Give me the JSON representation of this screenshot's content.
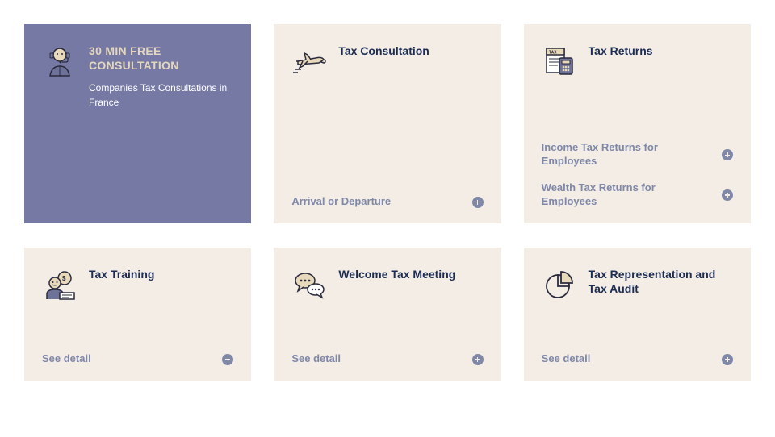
{
  "cards": [
    {
      "title": "30 MIN FREE CONSULTATION",
      "subtitle": "Companies Tax Consultations in France",
      "featured": true
    },
    {
      "title": "Tax Consultation",
      "links": [
        {
          "label": "Arrival or Departure"
        }
      ]
    },
    {
      "title": "Tax Returns",
      "links": [
        {
          "label": "Income Tax Returns for Employees"
        },
        {
          "label": "Wealth Tax Returns for Employees"
        }
      ]
    },
    {
      "title": "Tax Training",
      "links": [
        {
          "label": "See detail"
        }
      ]
    },
    {
      "title": "Welcome Tax Meeting",
      "links": [
        {
          "label": "See detail"
        }
      ]
    },
    {
      "title": "Tax Representation and Tax Audit",
      "links": [
        {
          "label": "See detail"
        }
      ]
    }
  ]
}
